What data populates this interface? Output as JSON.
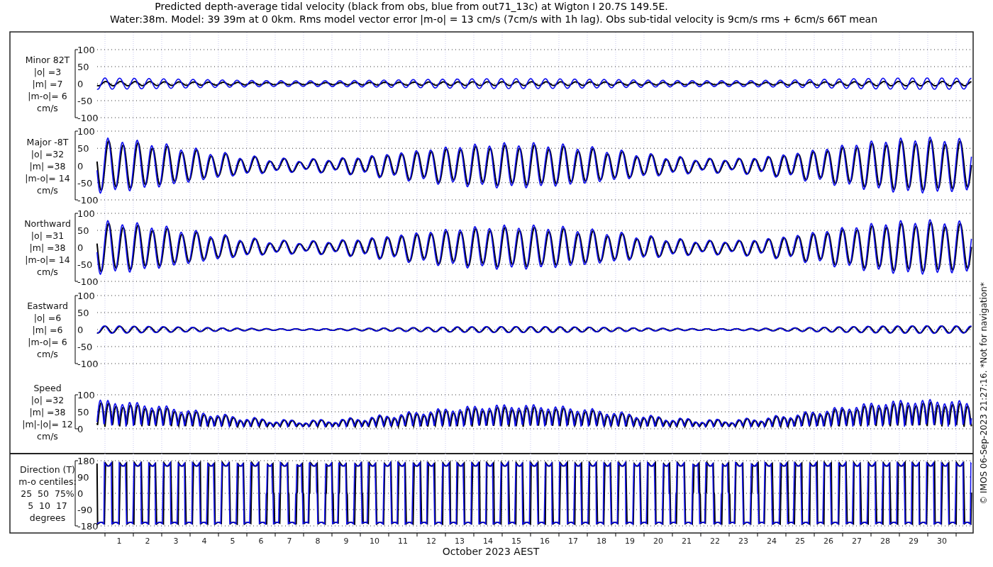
{
  "title_lines": [
    "Predicted depth-average tidal velocity (black from obs, blue from out71_13c) at Wigton I 20.7S 149.5E.",
    "Water:38m. Model: 39 39m at 0 0km. Rms model vector error |m-o| = 13 cm/s (7cm/s with 1h lag). Obs sub-tidal velocity is 9cm/s rms + 6cm/s 66T mean"
  ],
  "panels": [
    {
      "kind": "minor",
      "label_lines": [
        "Minor 82T",
        "|o| =3",
        "|m| =7",
        "|m-o|= 6",
        "cm/s"
      ],
      "yticks": [
        "100",
        "50",
        "0",
        "-50",
        "-100"
      ]
    },
    {
      "kind": "major",
      "label_lines": [
        "Major -8T",
        "|o| =32",
        "|m| =38",
        "|m-o|= 14",
        "cm/s"
      ],
      "yticks": [
        "100",
        "50",
        "0",
        "-50",
        "-100"
      ]
    },
    {
      "kind": "north",
      "label_lines": [
        "Northward",
        "|o| =31",
        "|m| =38",
        "|m-o|= 14",
        "cm/s"
      ],
      "yticks": [
        "100",
        "50",
        "0",
        "-50",
        "-100"
      ]
    },
    {
      "kind": "east",
      "label_lines": [
        "Eastward",
        "|o| =6",
        "|m| =6",
        "|m-o|= 6",
        "cm/s"
      ],
      "yticks": [
        "100",
        "50",
        "0",
        "-50",
        "-100"
      ]
    },
    {
      "kind": "speed",
      "label_lines": [
        "Speed",
        "|o| =32",
        "|m| =38",
        "|m|-|o|= 12",
        "cm/s"
      ],
      "yticks": [
        "100",
        "50",
        "0"
      ]
    },
    {
      "kind": "direction",
      "label_lines": [
        "Direction (T)",
        "m-o centiles:",
        "25  50  75%",
        "5  10  17",
        "degrees"
      ],
      "yticks": [
        "180",
        "90",
        "0",
        "-90",
        "-180"
      ]
    }
  ],
  "xticks": [
    "1",
    "2",
    "3",
    "4",
    "5",
    "6",
    "7",
    "8",
    "9",
    "10",
    "11",
    "12",
    "13",
    "14",
    "15",
    "16",
    "17",
    "18",
    "19",
    "20",
    "21",
    "22",
    "23",
    "24",
    "25",
    "26",
    "27",
    "28",
    "29",
    "30"
  ],
  "xlabel": "October 2023 AEST",
  "credit": "© IMOS 06-Sep-2023 21:27:16. *Not for navigation*"
}
